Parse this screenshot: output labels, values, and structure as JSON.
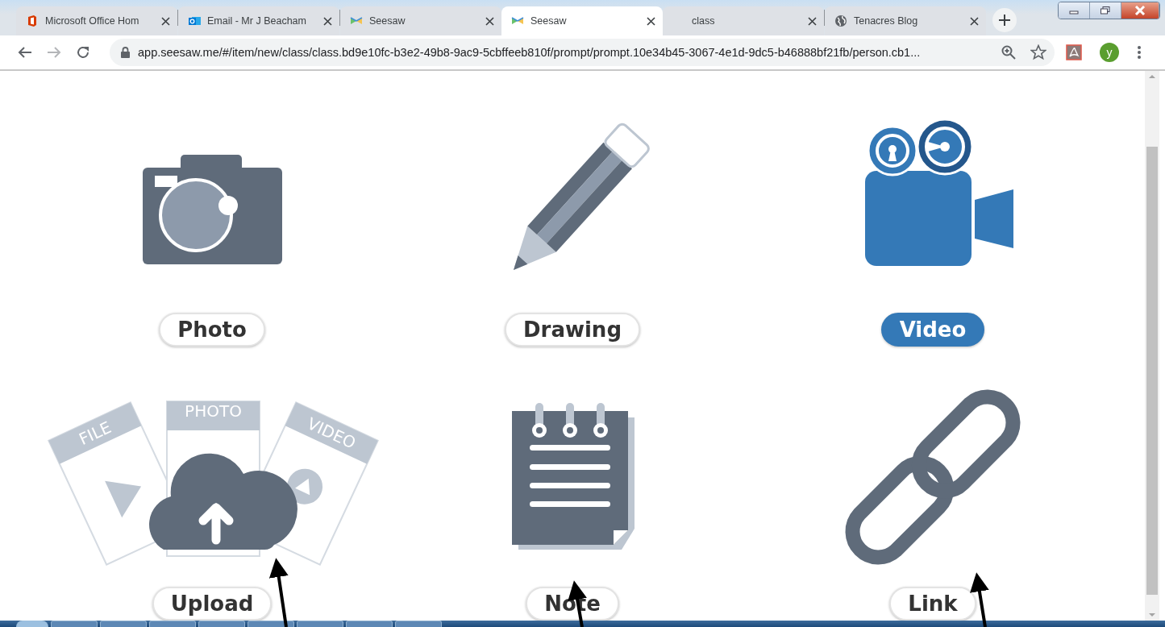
{
  "browser": {
    "tabs": [
      {
        "title": "Microsoft Office Hom",
        "kind": "office",
        "selected": false
      },
      {
        "title": "Email - Mr J Beacham",
        "kind": "mail",
        "selected": false
      },
      {
        "title": "Seesaw",
        "kind": "seesaw",
        "selected": false
      },
      {
        "title": "Seesaw",
        "kind": "seesaw",
        "selected": true
      },
      {
        "title": "class",
        "kind": "plain",
        "selected": false
      },
      {
        "title": "Tenacres Blog",
        "kind": "globe",
        "selected": false
      }
    ],
    "address": "app.seesaw.me/#/item/new/class/class.bd9e10fc-b3e2-49b8-9ac9-5cbffeeb810f/prompt/prompt.10e34b45-3067-4e1d-9dc5-b46888bf21fb/person.cb1...",
    "avatar": "y"
  },
  "options": [
    {
      "label": "Photo",
      "kind": "camera",
      "selected": false
    },
    {
      "label": "Drawing",
      "kind": "pencil",
      "selected": false
    },
    {
      "label": "Video",
      "kind": "video",
      "selected": true
    },
    {
      "label": "Upload",
      "kind": "upload",
      "selected": false,
      "card_labels": [
        "FILE",
        "PHOTO",
        "VIDEO"
      ]
    },
    {
      "label": "Note",
      "kind": "note",
      "selected": false
    },
    {
      "label": "Link",
      "kind": "link",
      "selected": false
    }
  ]
}
